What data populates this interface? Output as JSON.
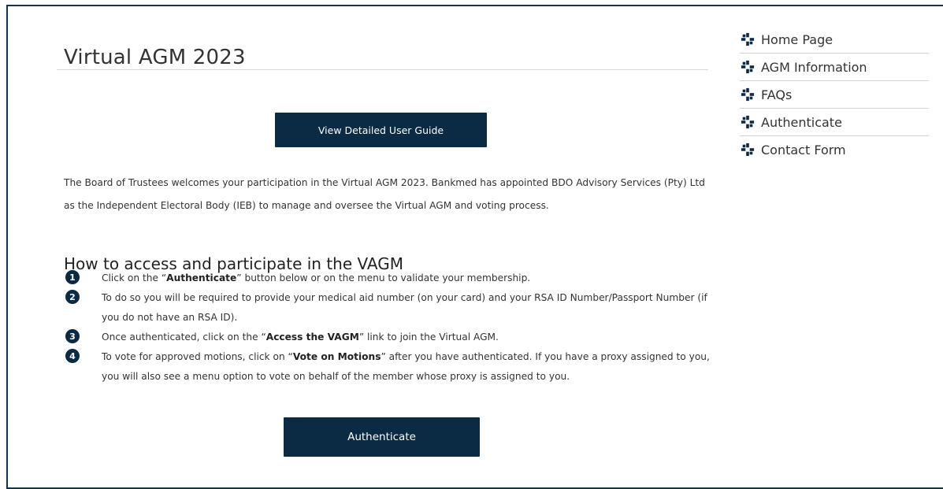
{
  "page": {
    "title": "Virtual AGM 2023",
    "accent_color": "#0b2a44"
  },
  "guide_button": {
    "label": "View Detailed User Guide"
  },
  "intro": {
    "text": "The Board of Trustees welcomes your participation in the Virtual AGM 2023. Bankmed has appointed BDO Advisory Services (Pty) Ltd as the Independent Electoral Body (IEB) to manage and oversee the Virtual AGM and voting process."
  },
  "access_section": {
    "heading": "How to access and participate in the VAGM",
    "steps": [
      {
        "number": "1",
        "before": "Click on the “",
        "bold": "Authenticate",
        "after": "” button below or on the menu to validate your membership."
      },
      {
        "number": "2",
        "before": "To do so you will be required to provide your medical aid number (on your card) and your RSA ID Number/Passport Number (if you do not have an RSA ID).",
        "bold": "",
        "after": ""
      },
      {
        "number": "3",
        "before": "Once authenticated, click on the “",
        "bold": "Access the VAGM",
        "after": "” link to join the Virtual AGM."
      },
      {
        "number": "4",
        "before": "To vote for approved motions, click on “",
        "bold": "Vote on Motions",
        "after": "” after you have authenticated. If you have a proxy assigned to you, you will also see a menu option to vote on behalf of the member whose proxy is assigned to you."
      }
    ]
  },
  "auth_button": {
    "label": "Authenticate"
  },
  "sidebar": {
    "icon": "bankmed-cross-icon",
    "items": [
      {
        "label": "Home Page"
      },
      {
        "label": "AGM Information"
      },
      {
        "label": "FAQs"
      },
      {
        "label": "Authenticate"
      },
      {
        "label": "Contact Form"
      }
    ]
  }
}
